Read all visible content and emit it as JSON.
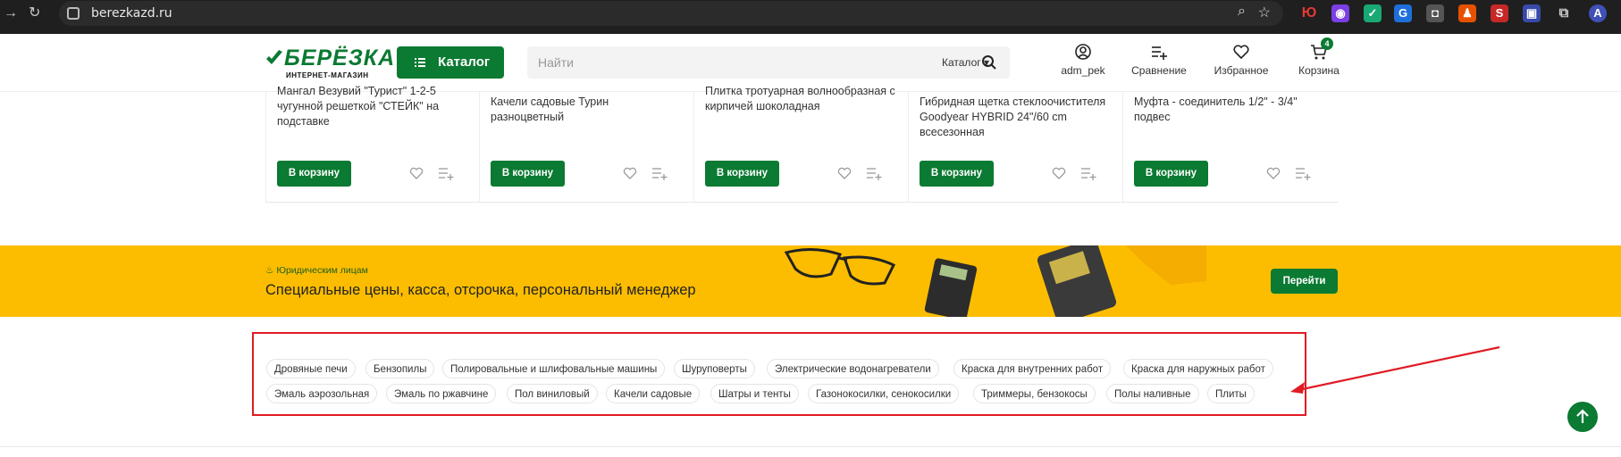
{
  "browser": {
    "url": "berezkazd.ru"
  },
  "header": {
    "logo_name": "БЕРЁЗКА",
    "logo_sub": "ИНТЕРНЕТ-МАГАЗИН",
    "catalog_label": "Каталог",
    "search_placeholder": "Найти",
    "search_scope": "Каталог",
    "user_label": "adm_pek",
    "compare_label": "Сравнение",
    "favorites_label": "Избранное",
    "cart_label": "Корзина",
    "cart_count": "4"
  },
  "products": [
    {
      "title": "Мангал Везувий \"Турист\" 1-2-5 чугунной решеткой \"СТЕЙК\" на подставке",
      "buy_label": "В корзину"
    },
    {
      "title": "Качели садовые Турин разноцветный",
      "buy_label": "В корзину"
    },
    {
      "title": "Плитка тротуарная волнообразная с кирпичей шоколадная",
      "buy_label": "В корзину"
    },
    {
      "title": "Гибридная щетка стеклоочистителя Goodyear HYBRID 24\"/60 cm всесезонная",
      "buy_label": "В корзину"
    },
    {
      "title": "Муфта - соединитель 1/2\" - 3/4\" подвес",
      "buy_label": "В корзину"
    }
  ],
  "banner": {
    "kicker": "Юридическим лицам",
    "headline": "Специальные цены, касса, отсрочка, персональный менеджер",
    "button_label": "Перейти"
  },
  "tags": {
    "row1": [
      "Дровяные печи",
      "Бензопилы",
      "Полировальные и шлифовальные машины",
      "Шуруповерты",
      "Электрические водонагреватели",
      "Краска для внутренних работ",
      "Краска для наружных работ"
    ],
    "row2": [
      "Эмаль аэрозольная",
      "Эмаль по ржавчине",
      "Пол виниловый",
      "Качели садовые",
      "Шатры и тенты",
      "Газонокосилки, сенокосилки",
      "Триммеры, бензокосы",
      "Полы наливные",
      "Плиты"
    ]
  },
  "colors": {
    "brand_green": "#0b7a32",
    "banner_yellow": "#fcbd00",
    "annotation_red": "#e01b24"
  }
}
